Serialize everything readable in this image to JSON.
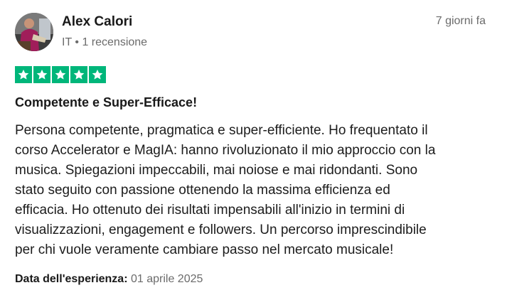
{
  "reviewer": {
    "name": "Alex Calori",
    "country": "IT",
    "separator": "•",
    "review_count": "1 recensione"
  },
  "review": {
    "relative_date": "7 giorni fa",
    "rating": 5,
    "star_color": "#00b67a",
    "title": "Competente e Super-Efficace!",
    "body_lines": [
      "Persona competente, pragmatica e super-efficiente. Ho frequentato il",
      "corso Accelerator e MagIA: hanno rivoluzionato il mio approccio con la",
      "musica. Spiegazioni impeccabili, mai noiose e mai ridondanti. Sono",
      "stato seguito con passione ottenendo la massima efficienza ed",
      "efficacia. Ho ottenuto dei risultati impensabili all'inizio in termini di",
      "visualizzazioni, engagement e followers. Un percorso imprescindibile",
      "per chi vuole veramente cambiare passo nel mercato musicale!"
    ],
    "experience_label": "Data dell'esperienza:",
    "experience_date": "01 aprile 2025"
  }
}
